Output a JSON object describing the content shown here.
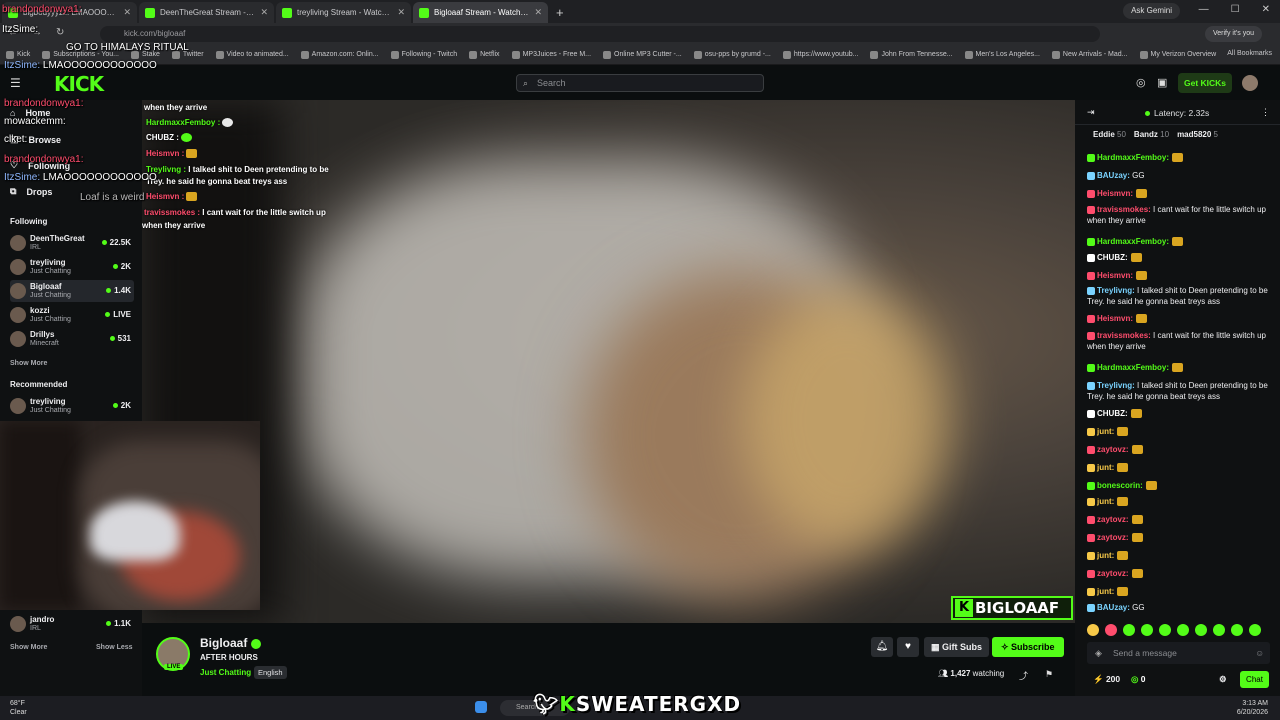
{
  "browser": {
    "tabs": [
      {
        "label": "bigbodyyyzz: LMAOOOOOOOOOOOO"
      },
      {
        "label": "DeenTheGreat Stream - Watch"
      },
      {
        "label": "treyliving Stream - Watch Live"
      },
      {
        "label": "Bigloaaf Stream - Watch Live"
      }
    ],
    "url": "kick.com/bigloaaf",
    "ask_gemini": "Ask Gemini",
    "verify": "Verify it's you",
    "bookmarks": [
      "Kick",
      "Subscriptions - You...",
      "Stake",
      "Twitter",
      "Video to animated...",
      "Amazon.com: Onlin...",
      "Following - Twitch",
      "Netflix",
      "MP3Juices - Free M...",
      "Online MP3 Cutter -...",
      "osu-pps by grumd -...",
      "https://www.youtub...",
      "John From Tennesse...",
      "Men's Los Angeles...",
      "New Arrivals - Mad...",
      "My Verizon Overview"
    ],
    "all_bookmarks": "All Bookmarks"
  },
  "kick": {
    "logo": "KICK",
    "search_placeholder": "Search",
    "get_kicks": "Get KICKs"
  },
  "sidebar": {
    "nav": [
      {
        "label": "Home"
      },
      {
        "label": "Browse"
      },
      {
        "label": "Following"
      },
      {
        "label": "Drops"
      }
    ],
    "following_header": "Following",
    "following": [
      {
        "name": "DeenTheGreat",
        "category": "IRL",
        "viewers": "22.5K"
      },
      {
        "name": "treyliving",
        "category": "Just Chatting",
        "viewers": "2K"
      },
      {
        "name": "Bigloaaf",
        "category": "Just Chatting",
        "viewers": "1.4K"
      },
      {
        "name": "kozzi",
        "category": "Just Chatting",
        "viewers": "LIVE"
      },
      {
        "name": "Drillys",
        "category": "Minecraft",
        "viewers": "531"
      }
    ],
    "show_more": "Show More",
    "recommended_header": "Recommended",
    "recommended": [
      {
        "name": "treyliving",
        "category": "Just Chatting",
        "viewers": "2K"
      },
      {
        "name": "jandro",
        "category": "IRL",
        "viewers": "1.1K"
      }
    ],
    "show_less": "Show Less"
  },
  "overlay_chat": [
    {
      "user": "brandondonwya1:",
      "text": ""
    },
    {
      "user": "mowackemm:",
      "text": ""
    },
    {
      "user": "clket:",
      "text": ""
    },
    {
      "user": "brandondonwya1:",
      "text": ""
    },
    {
      "user": "ItzSime:",
      "text": "LMAOOOOOOOOOOOO"
    },
    {
      "user": "",
      "text": "Loaf is a weird"
    },
    {
      "user": "",
      "text": "GO TO HIMALAYS RITUAL"
    },
    {
      "user": "ItzSime:",
      "text": "LMAOOOOOOOOOOOO"
    }
  ],
  "video_chat": [
    {
      "user": "",
      "text": "when they arrive"
    },
    {
      "user": "HardmaxxFemboy :",
      "text": ""
    },
    {
      "user": "CHUBZ :",
      "text": ""
    },
    {
      "user": "Heismvn :",
      "text": ""
    },
    {
      "user": "Treylivng :",
      "text": "I talked shit to Deen pretending to be"
    },
    {
      "user": "",
      "text": "Trey. he said he gonna beat treys ass"
    },
    {
      "user": "Heismvn :",
      "text": ""
    },
    {
      "user": "travissmokes :",
      "text": "I cant wait for the little switch up"
    },
    {
      "user": "",
      "text": "when they arrive"
    }
  ],
  "brand_logo": "BIGLOAAF",
  "stream": {
    "name": "Bigloaaf",
    "title": "AFTER HOURS",
    "category": "Just Chatting",
    "language": "English",
    "gift_subs": "Gift Subs",
    "subscribe": "Subscribe",
    "watching": "1,427",
    "watching_label": "watching",
    "live": "LIVE"
  },
  "chat": {
    "latency": "Latency: 2.32s",
    "gifters": [
      {
        "name": "Eddie",
        "count": "50"
      },
      {
        "name": "Bandz",
        "count": "10"
      },
      {
        "name": "mad5820",
        "count": "5"
      }
    ],
    "messages": [
      {
        "user": "HardmaxxFemboy:",
        "text": "",
        "color": "#53fc18"
      },
      {
        "user": "BAUzay:",
        "text": "GG",
        "color": "#7ad3ff"
      },
      {
        "user": "Heismvn:",
        "text": "",
        "color": "#ff4d6d"
      },
      {
        "user": "travissmokes:",
        "text": "I cant wait for the little switch up when they arrive",
        "color": "#ff4d6d"
      },
      {
        "user": "HardmaxxFemboy:",
        "text": "",
        "color": "#53fc18"
      },
      {
        "user": "CHUBZ:",
        "text": "",
        "color": "#ffffff"
      },
      {
        "user": "Heismvn:",
        "text": "",
        "color": "#ff4d6d"
      },
      {
        "user": "Treylivng:",
        "text": "I talked shit to Deen pretending to be Trey. he said he gonna beat treys ass",
        "color": "#7ad3ff"
      },
      {
        "user": "Heismvn:",
        "text": "",
        "color": "#ff4d6d"
      },
      {
        "user": "travissmokes:",
        "text": "I cant wait for the little switch up when they arrive",
        "color": "#ff4d6d"
      },
      {
        "user": "HardmaxxFemboy:",
        "text": "",
        "color": "#53fc18"
      },
      {
        "user": "Treylivng:",
        "text": "I talked shit to Deen pretending to be Trey. he said he gonna beat treys ass",
        "color": "#7ad3ff"
      },
      {
        "user": "CHUBZ:",
        "text": "",
        "color": "#ffffff"
      },
      {
        "user": "junt:",
        "text": "",
        "color": "#f7c948"
      },
      {
        "user": "zaytovz:",
        "text": "",
        "color": "#ff4d6d"
      },
      {
        "user": "junt:",
        "text": "",
        "color": "#f7c948"
      },
      {
        "user": "bonescorin:",
        "text": "",
        "color": "#53fc18"
      },
      {
        "user": "junt:",
        "text": "",
        "color": "#f7c948"
      },
      {
        "user": "zaytovz:",
        "text": "",
        "color": "#ff4d6d"
      },
      {
        "user": "zaytovz:",
        "text": "",
        "color": "#ff4d6d"
      },
      {
        "user": "junt:",
        "text": "",
        "color": "#f7c948"
      },
      {
        "user": "zaytovz:",
        "text": "",
        "color": "#ff4d6d"
      },
      {
        "user": "junt:",
        "text": "",
        "color": "#f7c948"
      },
      {
        "user": "BAUzay:",
        "text": "GG",
        "color": "#7ad3ff"
      }
    ],
    "send_placeholder": "Send a message",
    "points": "200",
    "kicks": "0",
    "chat_button": "Chat"
  },
  "taskbar": {
    "weather_temp": "68°F",
    "weather_cond": "Clear",
    "search": "Search",
    "overlay_name": "SWEATERGXD",
    "time": "3:13 AM",
    "date": "6/20/2026"
  }
}
